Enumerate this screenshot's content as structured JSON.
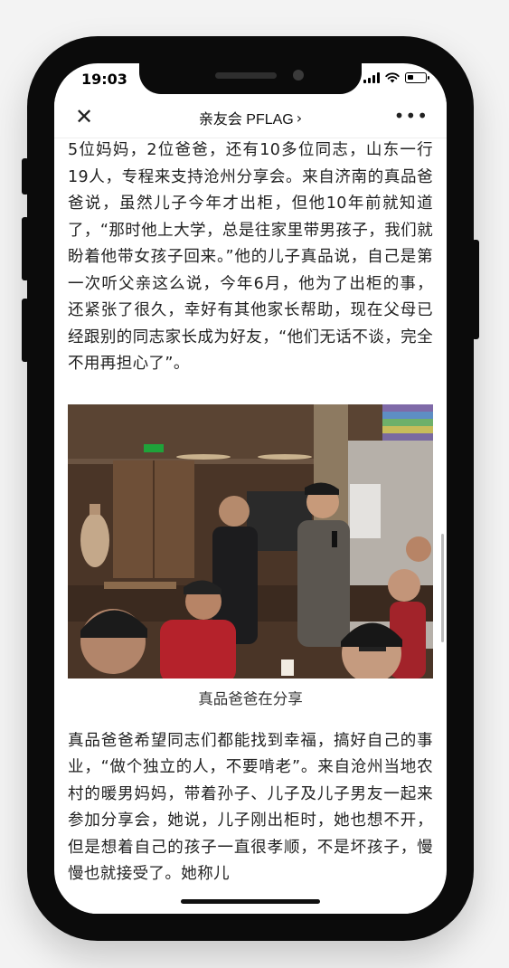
{
  "status_bar": {
    "time": "19:03"
  },
  "nav": {
    "title": "亲友会 PFLAG",
    "title_arrow": "›",
    "close_glyph": "✕",
    "more_glyph": "•••"
  },
  "article": {
    "paragraph1": "5位妈妈，2位爸爸，还有10多位同志，山东一行19人，专程来支持沧州分享会。来自济南的真品爸爸说，虽然儿子今年才出柜，但他10年前就知道了，“那时他上大学，总是往家里带男孩子，我们就盼着他带女孩子回来。”他的儿子真品说，自己是第一次听父亲这么说，今年6月，他为了出柜的事，还紧张了很久，幸好有其他家长帮助，现在父母已经跟别的同志家长成为好友，“他们无话不谈，完全不用再担心了”。",
    "photo_caption": "真品爸爸在分享",
    "paragraph2": "真品爸爸希望同志们都能找到幸福，搞好自己的事业，“做个独立的人，不要啃老”。来自沧州当地农村的暖男妈妈，带着孙子、儿子及儿子男友一起来参加分享会，她说，儿子刚出柜时，她也想不开，但是想着自己的孩子一直很孝顺，不是坏孩子，慢慢也就接受了。她称儿"
  },
  "icons": {
    "close": "close-icon",
    "more": "more-icon",
    "signal": "signal-icon",
    "wifi": "wifi-icon",
    "battery": "battery-icon"
  }
}
